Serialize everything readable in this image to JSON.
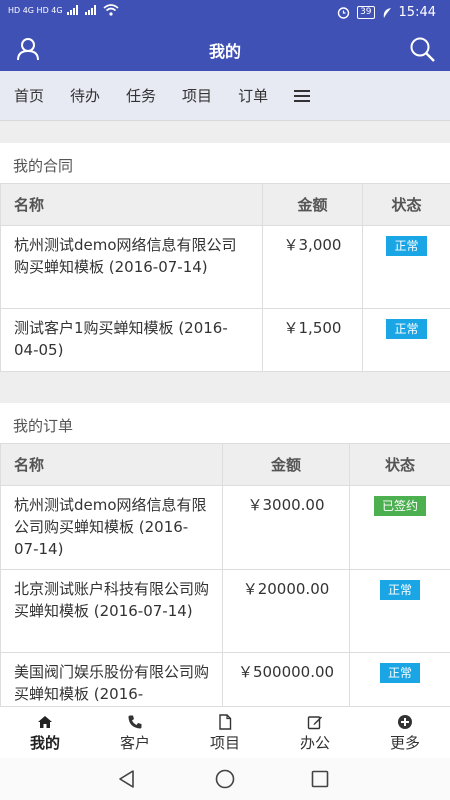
{
  "status_bar": {
    "left_indicators": "HD 4G HD 4G",
    "battery": "39",
    "time": "15:44"
  },
  "header": {
    "title": "我的",
    "left_icon": "user-icon",
    "right_icon": "search-icon"
  },
  "tabs": {
    "items": [
      {
        "label": "首页"
      },
      {
        "label": "待办"
      },
      {
        "label": "任务"
      },
      {
        "label": "项目"
      },
      {
        "label": "订单"
      }
    ],
    "more_icon": "menu-icon"
  },
  "contracts": {
    "title": "我的合同",
    "columns": {
      "name": "名称",
      "amount": "金额",
      "status": "状态"
    },
    "rows": [
      {
        "name": "杭州测试demo网络信息有限公司购买蝉知模板 (2016-07-14)",
        "amount": "￥3,000",
        "status": "正常",
        "status_color": "#1aa5e5"
      },
      {
        "name": "测试客户1购买蝉知模板 (2016-04-05)",
        "amount": "￥1,500",
        "status": "正常",
        "status_color": "#1aa5e5"
      }
    ]
  },
  "orders": {
    "title": "我的订单",
    "columns": {
      "name": "名称",
      "amount": "金额",
      "status": "状态"
    },
    "rows": [
      {
        "name": "杭州测试demo网络信息有限公司购买蝉知模板 (2016-07-14)",
        "amount": "￥3000.00",
        "status": "已签约",
        "status_color": "#4caf50"
      },
      {
        "name": "北京测试账户科技有限公司购买蝉知模板 (2016-07-14)",
        "amount": "￥20000.00",
        "status": "正常",
        "status_color": "#1aa5e5"
      },
      {
        "name": "美国阀门娱乐股份有限公司购买蝉知模板 (2016-",
        "amount": "￥500000.00",
        "status": "正常",
        "status_color": "#1aa5e5"
      }
    ]
  },
  "bottom_nav": {
    "items": [
      {
        "label": "我的",
        "icon": "home-icon",
        "active": true
      },
      {
        "label": "客户",
        "icon": "phone-icon",
        "active": false
      },
      {
        "label": "项目",
        "icon": "document-icon",
        "active": false
      },
      {
        "label": "办公",
        "icon": "edit-icon",
        "active": false
      },
      {
        "label": "更多",
        "icon": "plus-circle-icon",
        "active": false
      }
    ]
  },
  "colors": {
    "primary": "#3f51b5",
    "badge_normal": "#1aa5e5",
    "badge_signed": "#4caf50"
  }
}
